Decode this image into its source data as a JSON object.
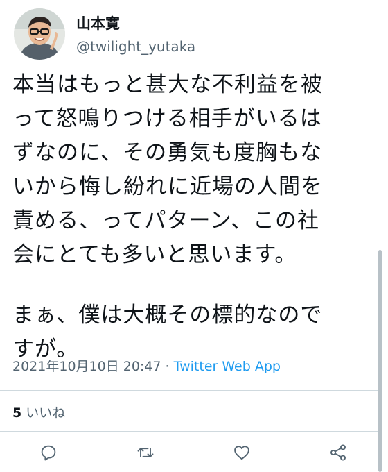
{
  "user": {
    "name": "山本寛",
    "handle": "@twilight_yutaka",
    "avatar_icon": "profile-photo"
  },
  "tweet": {
    "lines": [
      "本当はもっと甚大な不利益を被",
      "って怒鳴りつける相手がいるは",
      "ずなのに、その勇気も度胸もな",
      "いから悔し紛れに近場の人間を",
      "責める、ってパターン、この社",
      "会にとても多いと思います。",
      "",
      "まぁ、僕は大概その標的なので",
      "すが。"
    ]
  },
  "meta": {
    "timestamp": "2021年10月10日 20:47",
    "separator": " · ",
    "source": "Twitter Web App"
  },
  "likes": {
    "count": "5",
    "label": " いいね"
  },
  "actions": {
    "reply_icon": "speech-bubble",
    "retweet_icon": "retweet-arrows",
    "like_icon": "heart-outline",
    "share_icon": "share-nodes"
  },
  "colors": {
    "text": "#0f1419",
    "secondary": "#536471",
    "link": "#1d9bf0",
    "divider": "#cfd9de"
  }
}
